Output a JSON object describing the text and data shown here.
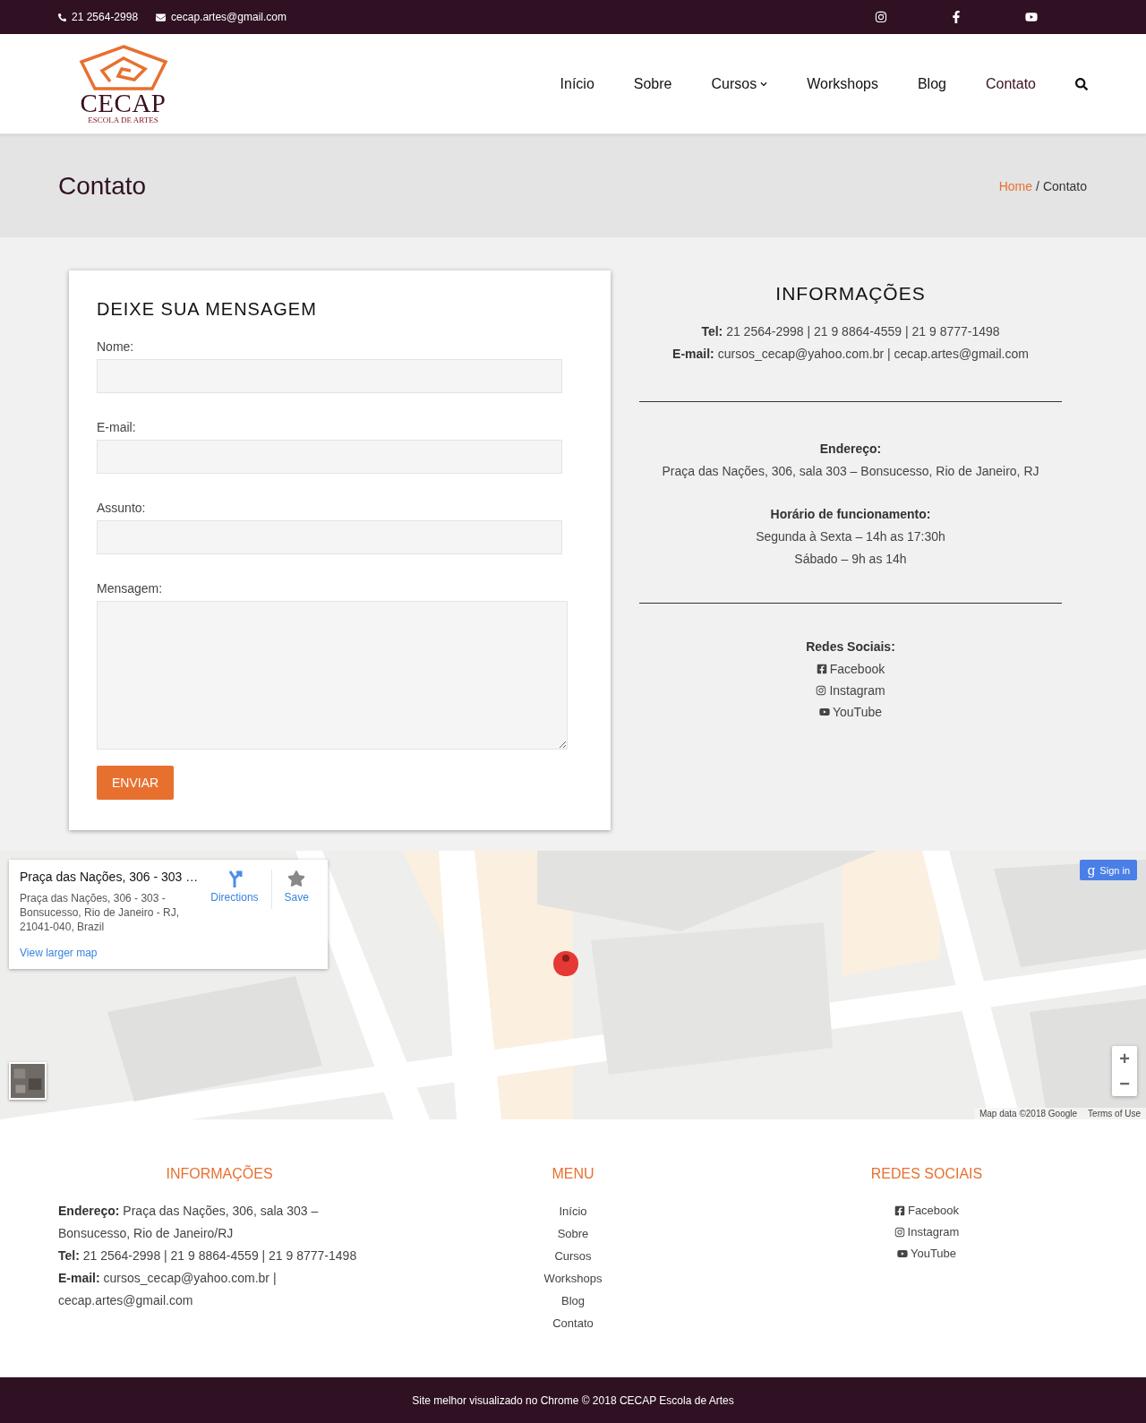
{
  "topbar": {
    "phone": "21 2564-2998",
    "email": "cecap.artes@gmail.com",
    "social": [
      {
        "kind": "instagram"
      },
      {
        "kind": "facebook"
      },
      {
        "kind": "youtube"
      }
    ]
  },
  "logo": {
    "name": "CECAP",
    "tagline": "ESCOLA DE ARTES"
  },
  "nav": [
    {
      "label": "Início",
      "selected": false,
      "dropdown": false
    },
    {
      "label": "Sobre",
      "selected": false,
      "dropdown": false
    },
    {
      "label": "Cursos",
      "selected": false,
      "dropdown": true
    },
    {
      "label": "Workshops",
      "selected": false,
      "dropdown": false
    },
    {
      "label": "Blog",
      "selected": false,
      "dropdown": false
    },
    {
      "label": "Contato",
      "selected": true,
      "dropdown": false
    }
  ],
  "page_title": "Contato",
  "breadcrumb": {
    "home": "Home",
    "separator": "/",
    "current": "Contato"
  },
  "form": {
    "title": "DEIXE SUA MENSAGEM",
    "fields": [
      {
        "label": "Nome:",
        "kind": "text"
      },
      {
        "label": "E-mail:",
        "kind": "text"
      },
      {
        "label": "Assunto:",
        "kind": "text"
      },
      {
        "label": "Mensagem:",
        "kind": "textarea"
      }
    ],
    "submit": "ENVIAR"
  },
  "info": {
    "title": "INFORMAÇÕES",
    "contact": [
      "**Tel:** 21 2564-2998 | 21 9 8864-4559 | 21 9 8777-1498",
      "**E-mail:** cursos_cecap@yahoo.com.br | cecap.artes@gmail.com"
    ],
    "address_label": "Endereço:",
    "address": "Praça das Nações, 306, sala 303 – Bonsucesso, Rio de Janeiro, RJ",
    "hours_label": "Horário de funcionamento:",
    "hours": [
      "Segunda à Sexta – 14h as 17:30h",
      "Sábado – 9h as 14h"
    ],
    "social_label": "Redes Sociais:",
    "social": [
      {
        "kind": "facebook",
        "label": "Facebook"
      },
      {
        "kind": "instagram",
        "label": "Instagram"
      },
      {
        "kind": "youtube",
        "label": "YouTube"
      }
    ]
  },
  "map": {
    "card": {
      "title": "Praça das Nações, 306 - 303 …",
      "address": "Praça das Nações, 306 - 303 - Bonsucesso, Rio de Janeiro - RJ, 21041-040, Brazil",
      "directions": "Directions",
      "save": "Save",
      "larger": "View larger map"
    },
    "sign_in_icon": "g",
    "sign_in": "Sign in",
    "zoom_in": "+",
    "zoom_out": "−",
    "attribution": "Map data ©2018 Google",
    "terms": "Terms of Use"
  },
  "footer": {
    "info": {
      "title": "INFORMAÇÕES",
      "lines": [
        "**Endereço:** Praça das Nações, 306, sala 303 – Bonsucesso, Rio de Janeiro/RJ",
        "**Tel:** 21 2564-2998 | 21 9 8864-4559 | 21 9 8777-1498",
        "**E-mail:** cursos_cecap@yahoo.com.br | cecap.artes@gmail.com"
      ]
    },
    "menu": {
      "title": "MENU",
      "items": [
        "Início",
        "Sobre",
        "Cursos",
        "Workshops",
        "Blog",
        "Contato"
      ]
    },
    "social": {
      "title": "REDES SOCIAIS",
      "items": [
        {
          "kind": "facebook",
          "label": "Facebook"
        },
        {
          "kind": "instagram",
          "label": "Instagram"
        },
        {
          "kind": "youtube",
          "label": "YouTube"
        }
      ]
    }
  },
  "copyright": "Site melhor visualizado no Chrome © 2018 CECAP Escola de Artes"
}
